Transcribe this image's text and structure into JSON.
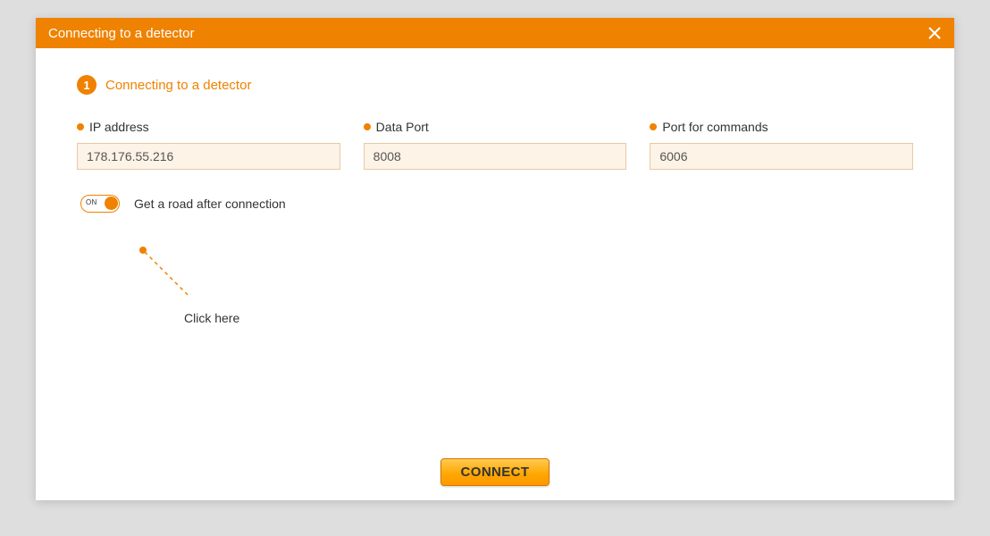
{
  "header": {
    "title": "Connecting to a detector"
  },
  "step": {
    "number": "1",
    "title": "Connecting to a detector"
  },
  "fields": {
    "ip": {
      "label": "IP address",
      "value": "178.176.55.216"
    },
    "dataPort": {
      "label": "Data Port",
      "value": "8008"
    },
    "cmdPort": {
      "label": "Port for commands",
      "value": "6006"
    }
  },
  "toggle": {
    "state": "ON",
    "label": "Get a road after connection"
  },
  "callout": {
    "text": "Click here"
  },
  "buttons": {
    "connect": "CONNECT"
  }
}
